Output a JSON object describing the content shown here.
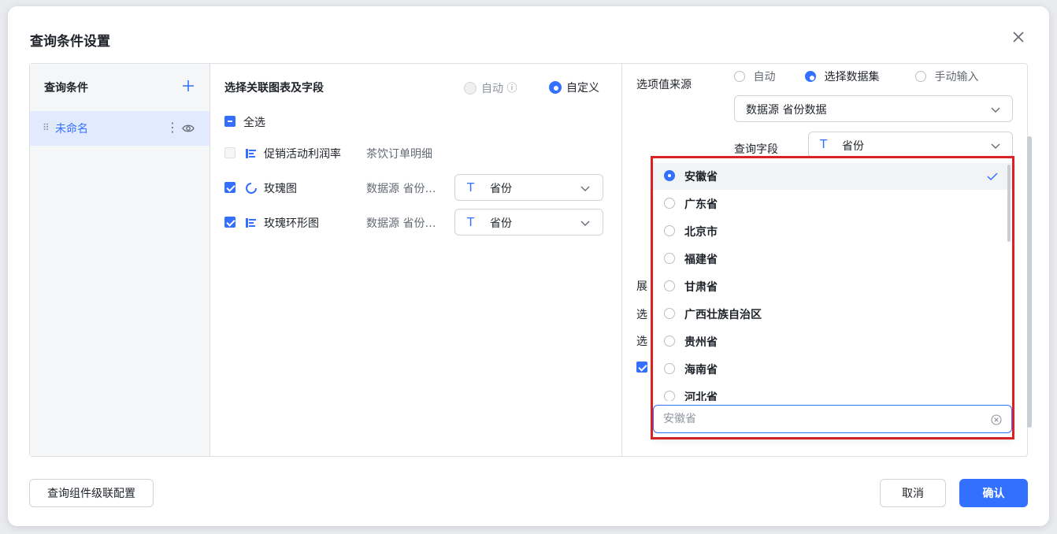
{
  "dialog": {
    "title": "查询条件设置"
  },
  "left": {
    "title": "查询条件",
    "items": [
      {
        "label": "未命名"
      }
    ]
  },
  "middle": {
    "title": "选择关联图表及字段",
    "mode_auto": "自动",
    "mode_custom": "自定义",
    "select_all": "全选",
    "rows": [
      {
        "name": "促销活动利润率",
        "source": "茶饮订单明细",
        "checked": false
      },
      {
        "name": "玫瑰图",
        "source": "数据源 省份…",
        "field": "省份",
        "checked": true
      },
      {
        "name": "玫瑰环形图",
        "source": "数据源 省份…",
        "field": "省份",
        "checked": true
      }
    ]
  },
  "right": {
    "option_source_label": "选项值来源",
    "option_source_options": [
      "自动",
      "选择数据集",
      "手动输入"
    ],
    "dataset_value": "数据源 省份数据",
    "query_field_label": "查询字段",
    "query_field_value": "省份",
    "partial_labels": [
      "展",
      "选",
      "选"
    ]
  },
  "dropdown": {
    "items": [
      "安徽省",
      "广东省",
      "北京市",
      "福建省",
      "甘肃省",
      "广西壮族自治区",
      "贵州省",
      "海南省",
      "河北省"
    ],
    "selected": "安徽省",
    "search_placeholder": "安徽省"
  },
  "footer": {
    "cascade_label": "查询组件级联配置",
    "cancel_label": "取消",
    "confirm_label": "确认"
  },
  "colors": {
    "primary": "#3370ff",
    "highlight_border": "#e02424"
  }
}
